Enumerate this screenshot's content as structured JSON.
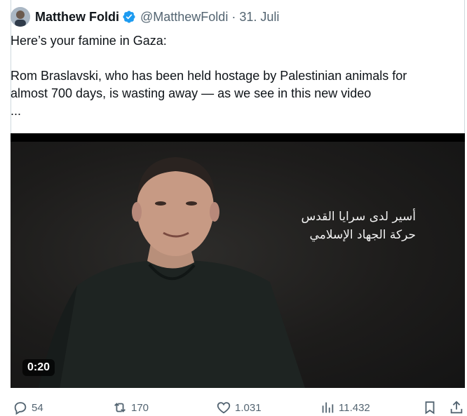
{
  "tweet": {
    "author_name": "Matthew Foldi",
    "handle": "@MatthewFoldi",
    "separator": "·",
    "date": "31. Juli",
    "text_line1": "Here’s your famine in Gaza:",
    "text_line2": "Rom Braslavski, who has been held hostage by Palestinian animals for",
    "text_line3": "almost 700 days, is wasting away — as we see in this new video",
    "text_more": "..."
  },
  "video": {
    "caption_line1": "أسير لدى سرايا القدس",
    "caption_line2": "حركة الجهاد الإسلامي",
    "timer": "0:20"
  },
  "actions": {
    "replies": "54",
    "reposts": "170",
    "likes": "1.031",
    "views": "11.432"
  },
  "colors": {
    "verified": "#1d9bf0",
    "muted": "#536471",
    "border": "#cfd9de"
  }
}
